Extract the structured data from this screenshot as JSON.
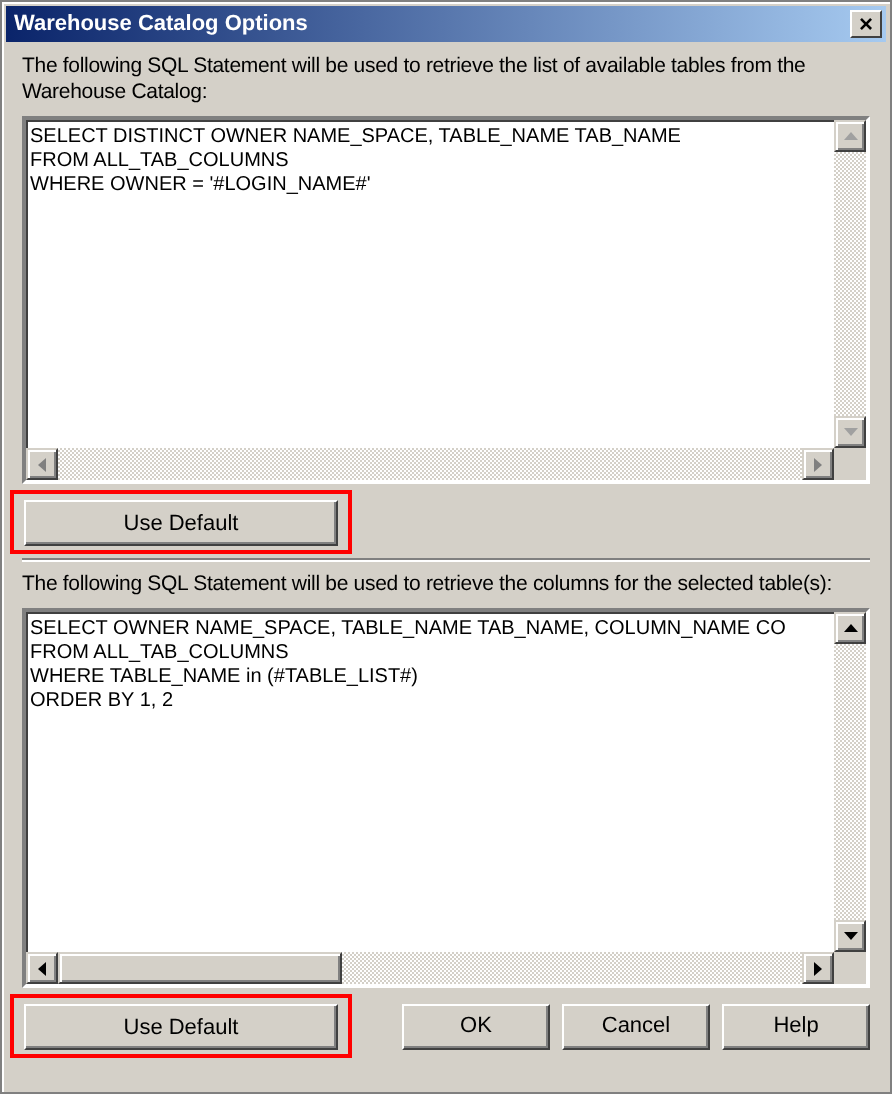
{
  "window": {
    "title": "Warehouse Catalog Options",
    "close": "×"
  },
  "sections": [
    {
      "label": "The following SQL Statement will be used to retrieve the list of available tables from the Warehouse Catalog:",
      "sql_lines": [
        "SELECT DISTINCT OWNER NAME_SPACE, TABLE_NAME TAB_NAME",
        "FROM ALL_TAB_COLUMNS",
        "WHERE OWNER = '#LOGIN_NAME#'"
      ],
      "scroll_arrows_enabled": false,
      "button": {
        "label": "Use Default",
        "highlighted": true
      }
    },
    {
      "label": "The following SQL Statement will be used to retrieve the columns for the selected table(s):",
      "sql_lines": [
        "SELECT OWNER NAME_SPACE, TABLE_NAME TAB_NAME, COLUMN_NAME CO",
        "FROM ALL_TAB_COLUMNS",
        "WHERE TABLE_NAME in (#TABLE_LIST#)",
        "ORDER BY 1, 2"
      ],
      "scroll_arrows_enabled": true,
      "button": {
        "label": "Use Default",
        "highlighted": true
      }
    }
  ],
  "buttons": [
    "OK",
    "Cancel",
    "Help"
  ]
}
